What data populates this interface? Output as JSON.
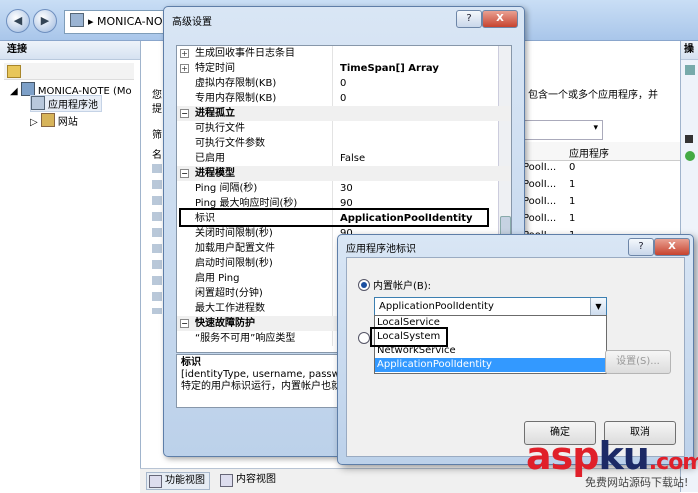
{
  "main": {
    "address": "MONICA-NO",
    "left_pane_title": "连接",
    "tree": [
      "MONICA-NOTE (Mo",
      "应用程序池",
      "网站"
    ],
    "right_pane_title": "操",
    "views": [
      "功能视图",
      "内容视图"
    ],
    "bg": {
      "help_line1": "包含一个或多个应用程序，并",
      "help_left1": "您",
      "help_left2": "提",
      "col_header": "应用程序",
      "rows": [
        {
          "v": "PoolI...",
          "n": "0"
        },
        {
          "v": "PoolI...",
          "n": "1"
        },
        {
          "v": "PoolI...",
          "n": "1"
        },
        {
          "v": "PoolI...",
          "n": "1"
        },
        {
          "v": "PoolI...",
          "n": "1"
        }
      ],
      "left_marks": [
        "筛",
        "名"
      ]
    }
  },
  "advanced": {
    "title": "高级设置",
    "title_help": "?",
    "title_close": "X",
    "rows": [
      {
        "name": "生成回收事件日志条目",
        "value": "",
        "type": "collapsed"
      },
      {
        "name": "特定时间",
        "value": "TimeSpan[] Array",
        "type": "collapsed",
        "bold": true
      },
      {
        "name": "虚拟内存限制(KB)",
        "value": "0",
        "type": "item"
      },
      {
        "name": "专用内存限制(KB)",
        "value": "0",
        "type": "item"
      },
      {
        "name": "进程孤立",
        "value": "",
        "type": "cat"
      },
      {
        "name": "可执行文件",
        "value": "",
        "type": "item"
      },
      {
        "name": "可执行文件参数",
        "value": "",
        "type": "item"
      },
      {
        "name": "已启用",
        "value": "False",
        "type": "item"
      },
      {
        "name": "进程模型",
        "value": "",
        "type": "cat"
      },
      {
        "name": "Ping 间隔(秒)",
        "value": "30",
        "type": "item"
      },
      {
        "name": "Ping 最大响应时间(秒)",
        "value": "90",
        "type": "item"
      },
      {
        "name": "标识",
        "value": "ApplicationPoolIdentity",
        "type": "item",
        "bold": true
      },
      {
        "name": "关闭时间限制(秒)",
        "value": "90",
        "type": "item"
      },
      {
        "name": "加载用户配置文件",
        "value": "",
        "type": "item"
      },
      {
        "name": "启动时间限制(秒)",
        "value": "",
        "type": "item"
      },
      {
        "name": "启用 Ping",
        "value": "",
        "type": "item"
      },
      {
        "name": "闲置超时(分钟)",
        "value": "",
        "type": "item"
      },
      {
        "name": "最大工作进程数",
        "value": "",
        "type": "item"
      },
      {
        "name": "快速故障防护",
        "value": "",
        "type": "cat"
      },
      {
        "name": "“服务不可用”响应类型",
        "value": "",
        "type": "item"
      }
    ],
    "desc_title": "标识",
    "desc_line1": "[identityType, username, passwo",
    "desc_line2": "特定的用户标识运行，内置帐户也就"
  },
  "identity": {
    "title": "应用程序池标识",
    "title_help": "?",
    "title_close": "X",
    "builtin_label": "内置帐户(B):",
    "selected": "ApplicationPoolIdentity",
    "options": [
      "LocalService",
      "LocalSystem",
      "NetworkService",
      "ApplicationPoolIdentity"
    ],
    "settings_button": "设置(S)...",
    "ok": "确定",
    "cancel": "取消"
  },
  "watermark": {
    "brand_a": "asp",
    "brand_b": "ku",
    "brand_c": ".com",
    "sub": "免费网站源码下载站!"
  }
}
